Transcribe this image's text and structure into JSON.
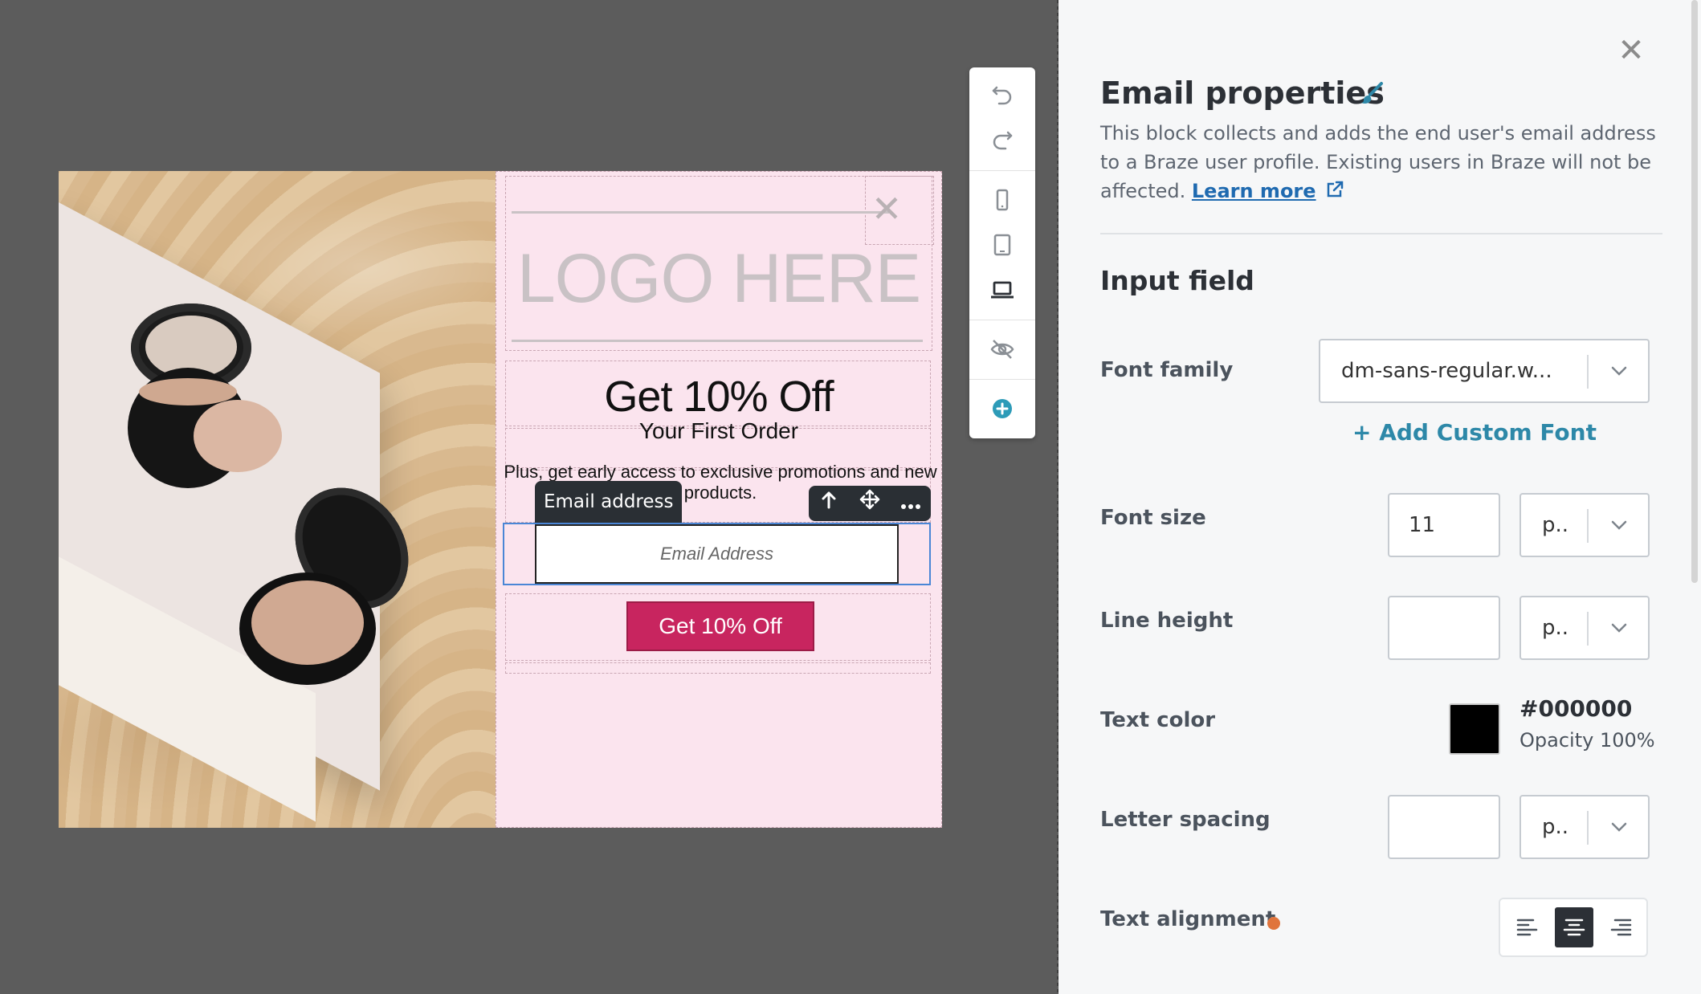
{
  "modal": {
    "logo_placeholder": "LOGO HERE",
    "close_glyph": "✕",
    "headline": "Get 10% Off",
    "subhead": "Your First Order",
    "body": "Plus, get early access to exclusive promotions and new products.",
    "block_label": "Email address",
    "email_placeholder": "Email Address",
    "cta_label": "Get 10% Off",
    "toolbar_icons": [
      "arrow-up-icon",
      "move-icon",
      "more-icon"
    ]
  },
  "tools": {
    "items": [
      "undo-icon",
      "redo-icon",
      "mobile-icon",
      "tablet-icon",
      "desktop-icon",
      "hide-icon",
      "add-icon"
    ]
  },
  "panel": {
    "close_glyph": "✕",
    "title": "Email properties",
    "description": "This block collects and adds the end user's email address to a Braze user profile. Existing users in Braze will not be affected.",
    "learn_more": "Learn more",
    "section_title": "Input field",
    "font_family": {
      "label": "Font family",
      "value": "dm-sans-regular.w..."
    },
    "add_custom_font": "+ Add Custom Font",
    "font_size": {
      "label": "Font size",
      "value": "11",
      "unit": "p.."
    },
    "line_height": {
      "label": "Line height",
      "value": "",
      "unit": "p.."
    },
    "text_color": {
      "label": "Text color",
      "hex": "#000000",
      "opacity": "Opacity 100%",
      "swatch": "#000000"
    },
    "letter_spacing": {
      "label": "Letter spacing",
      "value": "",
      "unit": "p.."
    },
    "text_alignment": {
      "label": "Text alignment",
      "selected": "center"
    }
  },
  "colors": {
    "canvas_bg": "#5c5c5c",
    "modal_bg": "#fbe4ee",
    "cta_bg": "#c8255f",
    "accent_teal": "#2d88a8",
    "link_blue": "#1f6ab0",
    "selection_blue": "#4a86d6",
    "indicator_orange": "#e0743c"
  }
}
